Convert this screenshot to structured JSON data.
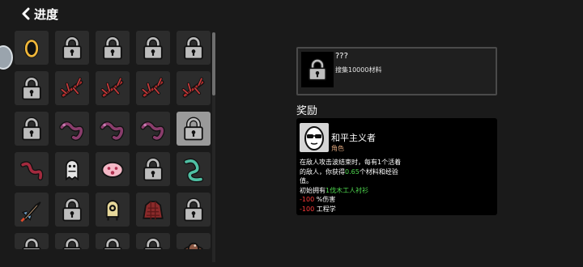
{
  "header": {
    "title": "进度"
  },
  "grid": {
    "cells": [
      {
        "icon": "egg-icon"
      },
      {
        "icon": "lock-icon"
      },
      {
        "icon": "lock-icon"
      },
      {
        "icon": "lock-icon"
      },
      {
        "icon": "lock-icon"
      },
      {
        "icon": "lock-icon"
      },
      {
        "icon": "red-branch-icon"
      },
      {
        "icon": "red-branch-icon"
      },
      {
        "icon": "red-branch-icon"
      },
      {
        "icon": "red-branch-icon"
      },
      {
        "icon": "lock-icon"
      },
      {
        "icon": "purple-worm-icon"
      },
      {
        "icon": "purple-worm-icon"
      },
      {
        "icon": "purple-worm-icon"
      },
      {
        "icon": "lock-icon",
        "selected": true
      },
      {
        "icon": "red-worm-icon"
      },
      {
        "icon": "ghost-creature-icon"
      },
      {
        "icon": "pink-blob-icon"
      },
      {
        "icon": "lock-icon"
      },
      {
        "icon": "teal-swirl-icon"
      },
      {
        "icon": "rocket-icon"
      },
      {
        "icon": "lock-icon"
      },
      {
        "icon": "bell-creature-icon"
      },
      {
        "icon": "red-coat-icon"
      },
      {
        "icon": "lock-icon"
      },
      {
        "icon": "lock-icon"
      },
      {
        "icon": "lock-icon"
      },
      {
        "icon": "lock-icon"
      },
      {
        "icon": "lock-icon"
      },
      {
        "icon": "brown-hat-icon"
      }
    ]
  },
  "info": {
    "icon": "lock-icon",
    "name": "???",
    "description": "搜集10000材料"
  },
  "reward": {
    "heading": "奖励",
    "icon": "sunglasses-egg-icon",
    "name": "和平主义者",
    "tag": "角色",
    "line1": "在敌人攻击波结束时，每有1个活着",
    "line2_a": "的敌人，你获得",
    "line2_value": "0.65",
    "line2_b": "个材料和经验",
    "line3": "值。",
    "line4_a": "初始拥有",
    "line4_item": "1伐木工人衬衫",
    "stat1_value": "-100",
    "stat1_label": " %伤害",
    "stat2_value": "-100",
    "stat2_label": " 工程学"
  },
  "colors": {
    "background": "#1a1a1a",
    "cell": "#2c2c2c",
    "selected_cell": "#9a9a9a",
    "positive": "#4fd84f",
    "negative": "#ff3b3b",
    "tag": "#d9a27a"
  }
}
